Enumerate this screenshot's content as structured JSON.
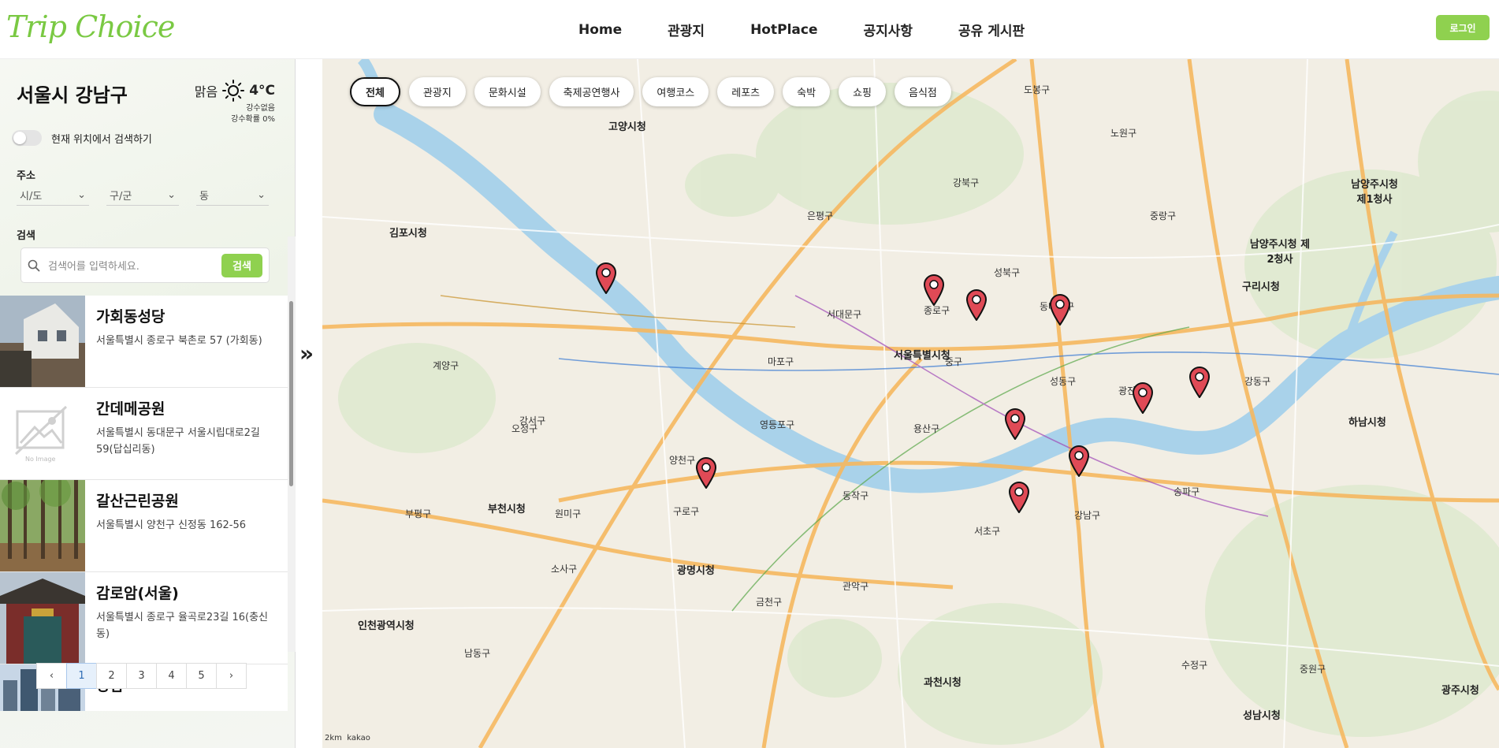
{
  "header": {
    "logo": "Trip Choice",
    "nav": [
      "Home",
      "관광지",
      "HotPlace",
      "공지사항",
      "공유 게시판"
    ],
    "login_label": "로그인"
  },
  "sidebar": {
    "region": "서울시 강남구",
    "weather": {
      "condition": "맑음",
      "temp": "4°C",
      "precip": "강수없음",
      "precip_prob": "강수확률 0%"
    },
    "toggle_label": "현재 위치에서 검색하기",
    "address_label": "주소",
    "selects": [
      "시/도",
      "구/군",
      "동"
    ],
    "search_label": "검색",
    "search_placeholder": "검색어를 입력하세요.",
    "search_button": "검색",
    "items": [
      {
        "title": "가회동성당",
        "addr": "서울특별시 종로구 북촌로 57 (가회동)"
      },
      {
        "title": "간데메공원",
        "addr": "서울특별시 동대문구 서울시립대로2길 59(답십리동)"
      },
      {
        "title": "갈산근린공원",
        "addr": "서울특별시 양천구 신정동 162-56"
      },
      {
        "title": "감로암(서울)",
        "addr": "서울특별시 종로구 율곡로23길 16(충신동)"
      },
      {
        "title": "강남",
        "addr": ""
      }
    ],
    "no_image_text": "No Image",
    "pages": [
      "1",
      "2",
      "3",
      "4",
      "5"
    ],
    "prev": "‹",
    "next": "›"
  },
  "map": {
    "chips": [
      "전체",
      "관광지",
      "문화시설",
      "축제공연행사",
      "여행코스",
      "레포츠",
      "숙박",
      "쇼핑",
      "음식점"
    ],
    "labels": [
      "고양시청",
      "김포시청",
      "서울특별시청",
      "부천시청",
      "광명시청",
      "구리시청",
      "남양주시청 제2청사",
      "하남시청",
      "인천광역시청",
      "과천시청",
      "성남시청",
      "광주시청",
      "남양주시청 제1청사",
      "강남구",
      "서초구",
      "송파구",
      "강동구",
      "마포구",
      "용산구",
      "영등포구",
      "구로구",
      "금천구",
      "관악구",
      "동작구",
      "양천구",
      "강서구",
      "은평구",
      "서대문구",
      "종로구",
      "중구",
      "성동구",
      "광진구",
      "동대문구",
      "성북구",
      "강북구",
      "도봉구",
      "노원구",
      "중랑구",
      "수정구",
      "중원구",
      "남동구",
      "소사구",
      "오정구",
      "원미구",
      "계양구",
      "부평구"
    ],
    "attribution": "kakao",
    "scale": "2km"
  }
}
